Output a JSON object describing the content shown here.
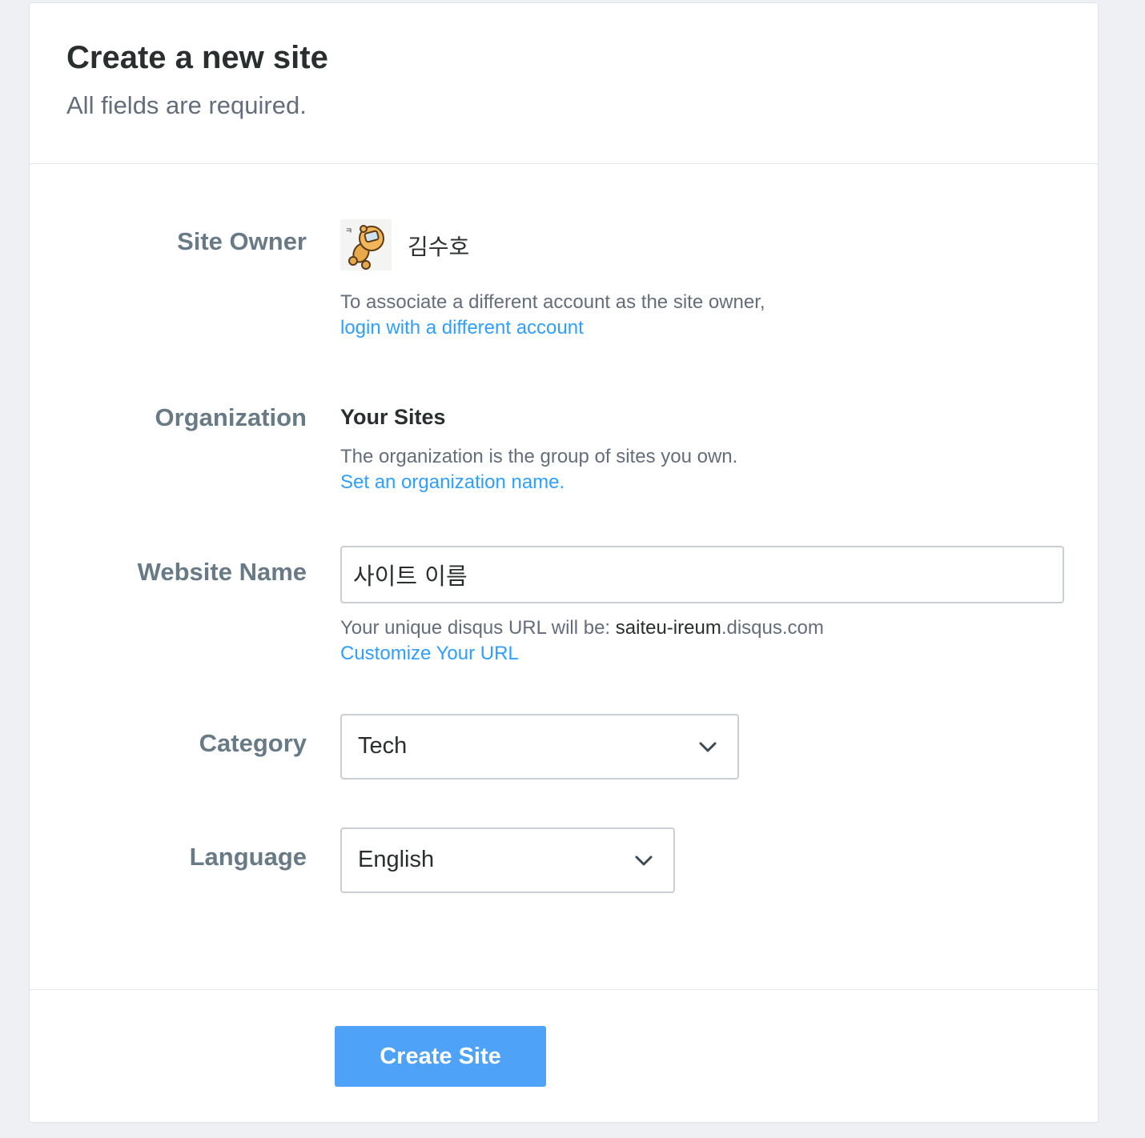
{
  "header": {
    "title": "Create a new site",
    "subtitle": "All fields are required."
  },
  "site_owner": {
    "label": "Site Owner",
    "name": "김수호",
    "avatar_icon": "bear-avatar-icon",
    "help_text": "To associate a different account as the site owner,",
    "link_text": "login with a different account"
  },
  "organization": {
    "label": "Organization",
    "name": "Your Sites",
    "help_text": "The organization is the group of sites you own.",
    "link_text": "Set an organization name."
  },
  "website_name": {
    "label": "Website Name",
    "value": "사이트 이름",
    "url_prefix": "Your unique disqus URL will be: ",
    "url_slug": "saiteu-ireum",
    "url_suffix": ".disqus.com",
    "link_text": "Customize Your URL"
  },
  "category": {
    "label": "Category",
    "selected": "Tech"
  },
  "language": {
    "label": "Language",
    "selected": "English"
  },
  "actions": {
    "create_label": "Create Site"
  },
  "colors": {
    "link": "#2e9fff",
    "button": "#4ea2f8",
    "label": "#687a86",
    "background": "#eef0f4"
  }
}
